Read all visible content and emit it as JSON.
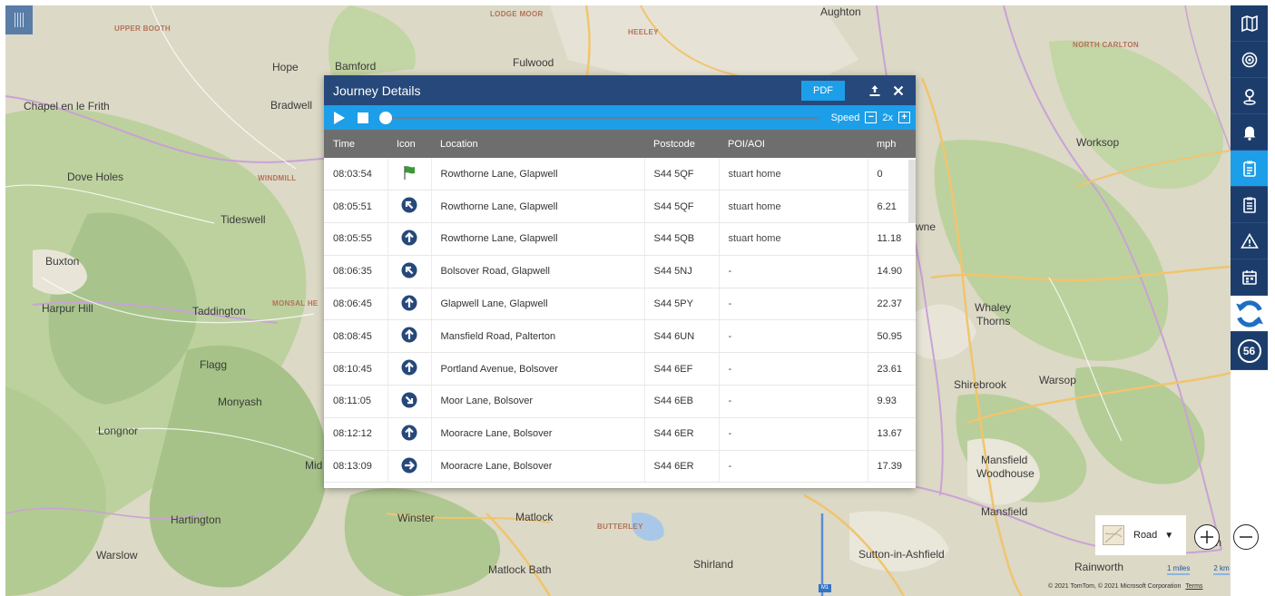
{
  "map": {
    "places": [
      {
        "name": "UPPER BOOTH",
        "small": true
      },
      {
        "name": "LODGE MOOR",
        "small": true
      },
      {
        "name": "HEELEY",
        "small": true
      },
      {
        "name": "Aughton",
        "small": false
      },
      {
        "name": "NORTH CARLTON",
        "small": true
      },
      {
        "name": "Hope",
        "small": false
      },
      {
        "name": "Bamford",
        "small": false
      },
      {
        "name": "Fulwood",
        "small": false
      },
      {
        "name": "Chapel en le Frith",
        "small": false
      },
      {
        "name": "Bradwell",
        "small": false
      },
      {
        "name": "Worksop",
        "small": false
      },
      {
        "name": "Dove Holes",
        "small": false
      },
      {
        "name": "WINDMILL",
        "small": true
      },
      {
        "name": "Tideswell",
        "small": false
      },
      {
        "name": "wne",
        "small": false
      },
      {
        "name": "Buxton",
        "small": false
      },
      {
        "name": "Harpur Hill",
        "small": false
      },
      {
        "name": "Taddington",
        "small": false
      },
      {
        "name": "MONSAL HE",
        "small": true
      },
      {
        "name": "Whaley",
        "small": false
      },
      {
        "name": "Thorns",
        "small": false
      },
      {
        "name": "Flagg",
        "small": false
      },
      {
        "name": "Shirebrook",
        "small": false
      },
      {
        "name": "Warsop",
        "small": false
      },
      {
        "name": "Monyash",
        "small": false
      },
      {
        "name": "Longnor",
        "small": false
      },
      {
        "name": "Mid",
        "small": false
      },
      {
        "name": "Mansfield",
        "small": false
      },
      {
        "name": "Woodhouse",
        "small": false
      },
      {
        "name": "Hartington",
        "small": false
      },
      {
        "name": "Winster",
        "small": false
      },
      {
        "name": "Matlock",
        "small": false
      },
      {
        "name": "BUTTERLEY",
        "small": true
      },
      {
        "name": "Mansfield",
        "small": false
      },
      {
        "name": "Warslow",
        "small": false
      },
      {
        "name": "Matlock Bath",
        "small": false
      },
      {
        "name": "Shirland",
        "small": false
      },
      {
        "name": "Sutton-in-Ashfield",
        "small": false
      },
      {
        "name": "Rainworth",
        "small": false
      },
      {
        "name": "th",
        "small": false
      }
    ],
    "motorway_shield": "M1",
    "map_type": "Road",
    "scale_miles": "1 miles",
    "scale_km": "2 km",
    "copyright": "© 2021 TomTom, © 2021 Microsoft Corporation",
    "terms": "Terms",
    "colors": {
      "land": "#dcd9c6",
      "green": "#b7cf97",
      "dark_green": "#a6c288",
      "road_orange": "#f1c46e",
      "road_purple": "#c9a2d6",
      "water": "#a9c8e8"
    }
  },
  "toolbar": {
    "buttons": [
      {
        "icon": "map-icon",
        "active": false
      },
      {
        "icon": "target-icon",
        "active": false
      },
      {
        "icon": "location-pin-icon",
        "active": false
      },
      {
        "icon": "bell-icon",
        "active": false
      },
      {
        "icon": "journey-document-icon",
        "active": true
      },
      {
        "icon": "clipboard-icon",
        "active": false
      },
      {
        "icon": "warning-icon",
        "active": false
      },
      {
        "icon": "calendar-icon",
        "active": false
      },
      {
        "icon": "refresh-icon",
        "active": false
      }
    ],
    "badge_count": "56",
    "colors": {
      "bg": "#1c3d6c",
      "active": "#1d9ee8"
    }
  },
  "panel": {
    "title": "Journey Details",
    "pdf_label": "PDF",
    "speed_label": "Speed",
    "speed_value": "2x",
    "minus_label": "−",
    "plus_label": "+",
    "playback_progress": 0,
    "columns": [
      "Time",
      "Icon",
      "Location",
      "Postcode",
      "POI/AOI",
      "mph"
    ],
    "rows": [
      {
        "time": "08:03:54",
        "icon": "start-flag-icon",
        "location": "Rowthorne Lane, Glapwell",
        "postcode": "S44 5QF",
        "poi": "stuart home",
        "mph": "0"
      },
      {
        "time": "08:05:51",
        "icon": "turn-left-icon",
        "location": "Rowthorne Lane, Glapwell",
        "postcode": "S44 5QF",
        "poi": "stuart home",
        "mph": "6.21"
      },
      {
        "time": "08:05:55",
        "icon": "straight-icon",
        "location": "Rowthorne Lane, Glapwell",
        "postcode": "S44 5QB",
        "poi": "stuart home",
        "mph": "11.18"
      },
      {
        "time": "08:06:35",
        "icon": "turn-left-icon",
        "location": "Bolsover Road, Glapwell",
        "postcode": "S44 5NJ",
        "poi": "-",
        "mph": "14.90"
      },
      {
        "time": "08:06:45",
        "icon": "straight-icon",
        "location": "Glapwell Lane, Glapwell",
        "postcode": "S44 5PY",
        "poi": "-",
        "mph": "22.37"
      },
      {
        "time": "08:08:45",
        "icon": "straight-icon",
        "location": "Mansfield Road, Palterton",
        "postcode": "S44 6UN",
        "poi": "-",
        "mph": "50.95"
      },
      {
        "time": "08:10:45",
        "icon": "straight-icon",
        "location": "Portland Avenue, Bolsover",
        "postcode": "S44 6EF",
        "poi": "-",
        "mph": "23.61"
      },
      {
        "time": "08:11:05",
        "icon": "turn-right-down-icon",
        "location": "Moor Lane, Bolsover",
        "postcode": "S44 6EB",
        "poi": "-",
        "mph": "9.93"
      },
      {
        "time": "08:12:12",
        "icon": "straight-icon",
        "location": "Mooracre Lane, Bolsover",
        "postcode": "S44 6ER",
        "poi": "-",
        "mph": "13.67"
      },
      {
        "time": "08:13:09",
        "icon": "turn-right-icon",
        "location": "Mooracre Lane, Bolsover",
        "postcode": "S44 6ER",
        "poi": "-",
        "mph": "17.39"
      }
    ],
    "colors": {
      "header": "#26487a",
      "player": "#1d9ee8",
      "table_head": "#6e6e6e",
      "direction_icon": "#26487a",
      "flag": "#3c9a36"
    }
  }
}
